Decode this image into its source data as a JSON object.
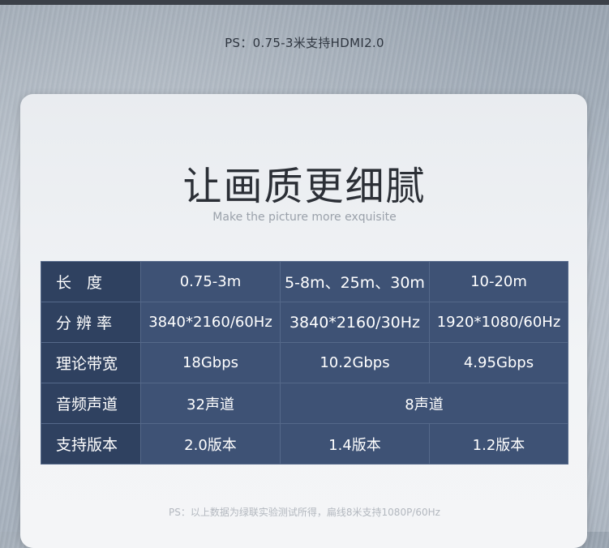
{
  "top_note": "PS：0.75-3米支持HDMI2.0",
  "title": "让画质更细腻",
  "subtitle": "Make the picture more exquisite",
  "table": {
    "rows": [
      {
        "header": "长　度",
        "cells": [
          "0.75-3m",
          "5-8m、25m、30m",
          "10-20m"
        ]
      },
      {
        "header": "分 辨 率",
        "cells": [
          "3840*2160/60Hz",
          "3840*2160/30Hz",
          "1920*1080/60Hz"
        ]
      },
      {
        "header": "理论带宽",
        "cells": [
          "18Gbps",
          "10.2Gbps",
          "4.95Gbps"
        ]
      },
      {
        "header": "音频声道",
        "cells": [
          "32声道",
          "8声道"
        ]
      },
      {
        "header": "支持版本",
        "cells": [
          "2.0版本",
          "1.4版本",
          "1.2版本"
        ]
      }
    ]
  },
  "footnote": "PS：以上数据为绿联实验测试所得，扁线8米支持1080P/60Hz",
  "colors": {
    "header_bg": "#2f4160",
    "cell_bg": "#3e5275",
    "card_bg": "#f2f4f6"
  }
}
